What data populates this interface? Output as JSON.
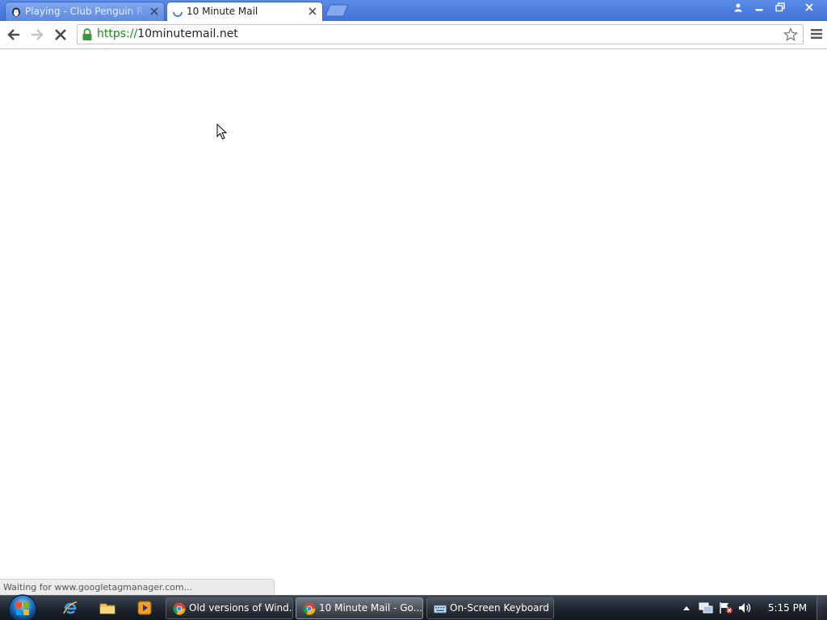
{
  "browser": {
    "tabs": [
      {
        "title": "Playing - Club Penguin Re",
        "favicon": "penguin-icon",
        "active": false
      },
      {
        "title": "10 Minute Mail",
        "favicon": "loading-spinner-icon",
        "active": true
      }
    ],
    "address_bar": {
      "scheme": "https://",
      "host": "10minutemail.net",
      "secure": true
    },
    "status_text": "Waiting for www.googletagmanager.com..."
  },
  "taskbar": {
    "quick_launch": [
      "internet-explorer-icon",
      "folder-icon",
      "media-player-icon"
    ],
    "buttons": [
      {
        "label": "Old versions of Wind...",
        "icon": "chrome-icon",
        "active": false
      },
      {
        "label": "10 Minute Mail - Go...",
        "icon": "chrome-icon",
        "active": true
      },
      {
        "label": "On-Screen Keyboard",
        "icon": "keyboard-icon",
        "active": false
      }
    ],
    "clock": "5:15 PM"
  },
  "colors": {
    "tabstrip": "#4a7fdf",
    "secure_scheme": "#1a8a1a",
    "taskbar": "#1c232c"
  }
}
